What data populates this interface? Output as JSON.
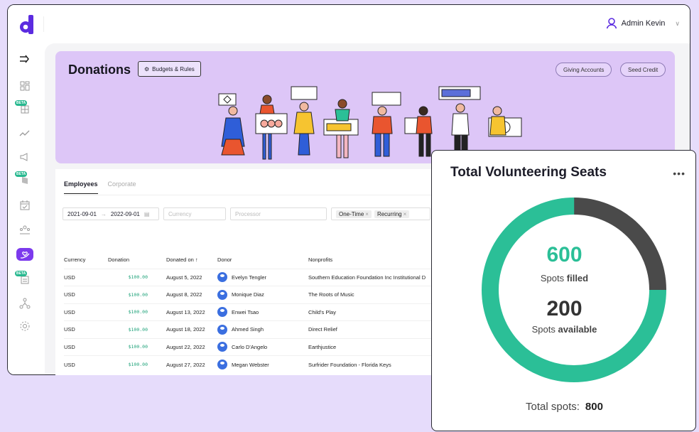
{
  "user": {
    "name": "Admin Kevin"
  },
  "page": {
    "title": "Donations",
    "budgets_button": "Budgets & Rules"
  },
  "header_actions": {
    "giving_accounts": "Giving Accounts",
    "seed_credit": "Seed Credit"
  },
  "tabs": [
    {
      "label": "Employees",
      "active": true
    },
    {
      "label": "Corporate",
      "active": false
    }
  ],
  "filters": {
    "date_from": "2021-09-01",
    "date_to": "2022-09-01",
    "currency_placeholder": "Currency",
    "processor_placeholder": "Processor",
    "type_chips": [
      "One-Time",
      "Recurring"
    ]
  },
  "table": {
    "columns": [
      "Currency",
      "Donation",
      "Donated on",
      "Donor",
      "Nonprofits"
    ],
    "rows": [
      {
        "currency": "USD",
        "donation": "$100.00",
        "date": "August 5, 2022",
        "donor": "Evelyn Tengler",
        "nonprofit": "Southern Education Foundation Inc Institutional D"
      },
      {
        "currency": "USD",
        "donation": "$100.00",
        "date": "August 8, 2022",
        "donor": "Monique Diaz",
        "nonprofit": "The Roots of Music"
      },
      {
        "currency": "USD",
        "donation": "$100.00",
        "date": "August 13, 2022",
        "donor": "Enwei Tsao",
        "nonprofit": "Child's Play"
      },
      {
        "currency": "USD",
        "donation": "$100.00",
        "date": "August 18, 2022",
        "donor": "Ahmed Singh",
        "nonprofit": "Direct Relief"
      },
      {
        "currency": "USD",
        "donation": "$100.00",
        "date": "August 22, 2022",
        "donor": "Carlo D'Angelo",
        "nonprofit": "Earthjustice"
      },
      {
        "currency": "USD",
        "donation": "$100.00",
        "date": "August 27, 2022",
        "donor": "Megan Webster",
        "nonprofit": "Surfrider Foundation - Florida Keys"
      }
    ]
  },
  "volunteer_card": {
    "title": "Total Volunteering Seats",
    "filled": {
      "value": "600",
      "label_prefix": "Spots",
      "label_bold": "filled"
    },
    "available": {
      "value": "200",
      "label_prefix": "Spots",
      "label_bold": "available"
    },
    "total_label": "Total spots:",
    "total_value": "800",
    "colors": {
      "filled": "#2bbf97",
      "available": "#4a4a4a"
    }
  }
}
